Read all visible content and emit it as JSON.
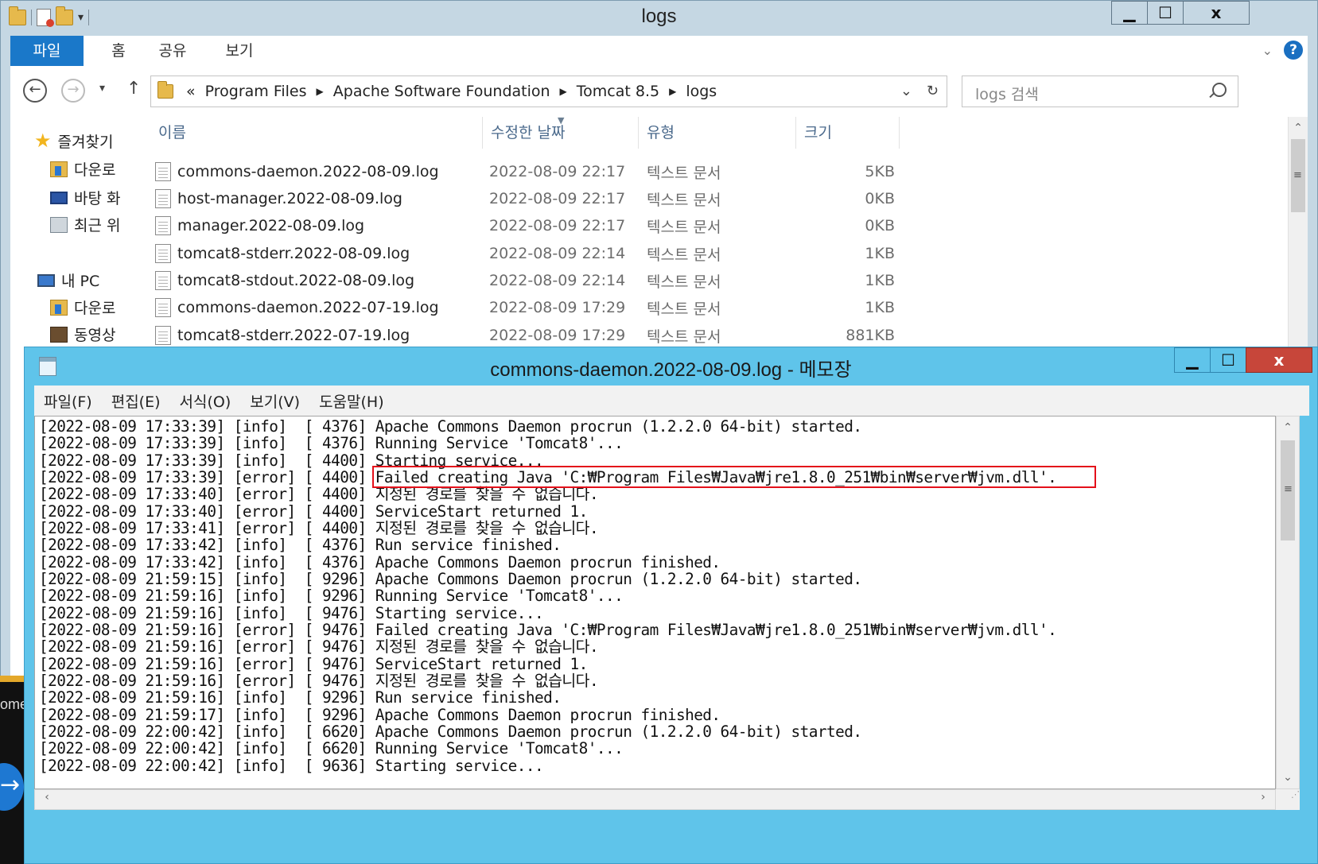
{
  "explorer": {
    "title": "logs",
    "window_buttons": {
      "minimize": "▁",
      "maximize": "☐",
      "close": "x"
    },
    "ribbon_tabs": [
      "파일",
      "홈",
      "공유",
      "보기"
    ],
    "help": "?",
    "address_crumbs": [
      "Program Files",
      "Apache Software Foundation",
      "Tomcat 8.5",
      "logs"
    ],
    "address_overflow": "«",
    "search_placeholder": "logs 검색",
    "nav_pane": [
      {
        "label": "즐겨찾기",
        "icon": "star-icon"
      },
      {
        "label": "다운로",
        "icon": "downloads-icon"
      },
      {
        "label": "바탕 화",
        "icon": "desktop-icon"
      },
      {
        "label": "최근 위",
        "icon": "recent-places-icon"
      },
      {
        "label": "내 PC",
        "icon": "this-pc-icon"
      },
      {
        "label": "다운로",
        "icon": "downloads-icon"
      },
      {
        "label": "동영상",
        "icon": "videos-icon"
      }
    ],
    "columns": [
      "이름",
      "수정한 날짜",
      "유형",
      "크기"
    ],
    "files": [
      {
        "name": "commons-daemon.2022-08-09.log",
        "date": "2022-08-09 22:17",
        "type": "텍스트 문서",
        "size": "5KB"
      },
      {
        "name": "host-manager.2022-08-09.log",
        "date": "2022-08-09 22:17",
        "type": "텍스트 문서",
        "size": "0KB"
      },
      {
        "name": "manager.2022-08-09.log",
        "date": "2022-08-09 22:17",
        "type": "텍스트 문서",
        "size": "0KB"
      },
      {
        "name": "tomcat8-stderr.2022-08-09.log",
        "date": "2022-08-09 22:14",
        "type": "텍스트 문서",
        "size": "1KB"
      },
      {
        "name": "tomcat8-stdout.2022-08-09.log",
        "date": "2022-08-09 22:14",
        "type": "텍스트 문서",
        "size": "1KB"
      },
      {
        "name": "commons-daemon.2022-07-19.log",
        "date": "2022-08-09 17:29",
        "type": "텍스트 문서",
        "size": "1KB"
      },
      {
        "name": "tomcat8-stderr.2022-07-19.log",
        "date": "2022-08-09 17:29",
        "type": "텍스트 문서",
        "size": "881KB"
      }
    ]
  },
  "notepad": {
    "title": "commons-daemon.2022-08-09.log - 메모장",
    "menu": [
      "파일(F)",
      "편집(E)",
      "서식(O)",
      "보기(V)",
      "도움말(H)"
    ],
    "highlight_color": "#e4101a",
    "lines": [
      "[2022-08-09 17:33:39] [info]  [ 4376] Apache Commons Daemon procrun (1.2.2.0 64-bit) started.",
      "[2022-08-09 17:33:39] [info]  [ 4376] Running Service 'Tomcat8'...",
      "[2022-08-09 17:33:39] [info]  [ 4400] Starting service...",
      "[2022-08-09 17:33:39] [error] [ 4400] Failed creating Java 'C:₩Program Files₩Java₩jre1.8.0_251₩bin₩server₩jvm.dll'.",
      "[2022-08-09 17:33:40] [error] [ 4400] 지정된 경로를 찾을 수 없습니다.",
      "[2022-08-09 17:33:40] [error] [ 4400] ServiceStart returned 1.",
      "[2022-08-09 17:33:41] [error] [ 4400] 지정된 경로를 찾을 수 없습니다.",
      "[2022-08-09 17:33:42] [info]  [ 4376] Run service finished.",
      "[2022-08-09 17:33:42] [info]  [ 4376] Apache Commons Daemon procrun finished.",
      "[2022-08-09 21:59:15] [info]  [ 9296] Apache Commons Daemon procrun (1.2.2.0 64-bit) started.",
      "[2022-08-09 21:59:16] [info]  [ 9296] Running Service 'Tomcat8'...",
      "[2022-08-09 21:59:16] [info]  [ 9476] Starting service...",
      "[2022-08-09 21:59:16] [error] [ 9476] Failed creating Java 'C:₩Program Files₩Java₩jre1.8.0_251₩bin₩server₩jvm.dll'.",
      "[2022-08-09 21:59:16] [error] [ 9476] 지정된 경로를 찾을 수 없습니다.",
      "[2022-08-09 21:59:16] [error] [ 9476] ServiceStart returned 1.",
      "[2022-08-09 21:59:16] [error] [ 9476] 지정된 경로를 찾을 수 없습니다.",
      "[2022-08-09 21:59:16] [info]  [ 9296] Run service finished.",
      "[2022-08-09 21:59:17] [info]  [ 9296] Apache Commons Daemon procrun finished.",
      "[2022-08-09 22:00:42] [info]  [ 6620] Apache Commons Daemon procrun (1.2.2.0 64-bit) started.",
      "[2022-08-09 22:00:42] [info]  [ 6620] Running Service 'Tomcat8'...",
      "[2022-08-09 22:00:42] [info]  [ 9636] Starting service..."
    ]
  },
  "background": {
    "partial_text": "ome"
  }
}
